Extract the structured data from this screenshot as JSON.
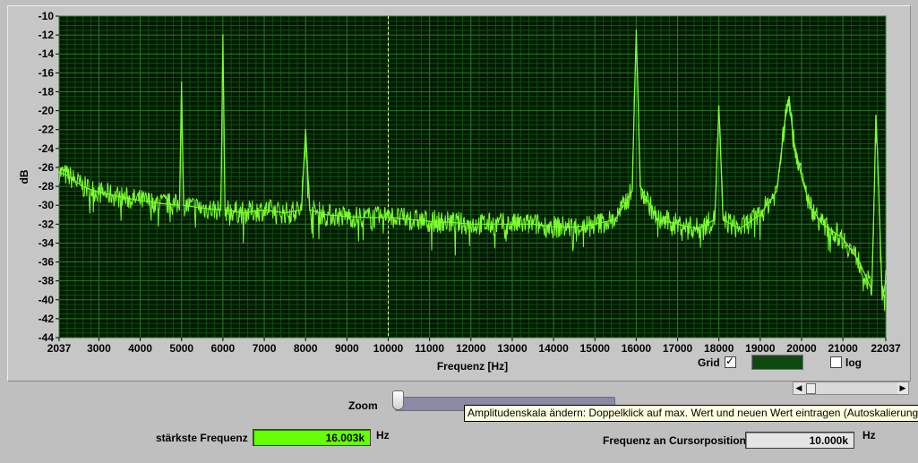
{
  "chart_data": {
    "type": "line",
    "xlabel": "Frequenz [Hz]",
    "ylabel": "dB",
    "xlim": [
      2037,
      22037
    ],
    "ylim": [
      -44,
      -10
    ],
    "xticks": [
      2037,
      3000,
      4000,
      5000,
      6000,
      7000,
      8000,
      9000,
      10000,
      11000,
      12000,
      13000,
      14000,
      15000,
      16000,
      17000,
      18000,
      19000,
      20000,
      21000,
      22037
    ],
    "yticks": [
      -10,
      -12,
      -14,
      -16,
      -18,
      -20,
      -22,
      -24,
      -26,
      -28,
      -30,
      -32,
      -34,
      -36,
      -38,
      -40,
      -42,
      -44
    ],
    "grid": true,
    "cursor_x": 10000,
    "series": [
      {
        "color": "#7cff2e",
        "x": [
          2037,
          2300,
          2600,
          2900,
          3200,
          3600,
          4000,
          4500,
          4950,
          5000,
          5050,
          5500,
          5950,
          6000,
          6050,
          6500,
          7000,
          7500,
          7900,
          8000,
          8100,
          8500,
          9000,
          9500,
          9900,
          10000,
          10100,
          10500,
          11000,
          11500,
          12000,
          12500,
          13000,
          13500,
          14000,
          14500,
          15000,
          15500,
          15900,
          16000,
          16100,
          16500,
          17000,
          17500,
          17900,
          18000,
          18100,
          18500,
          19000,
          19400,
          19600,
          19700,
          19800,
          20000,
          20200,
          20500,
          21000,
          21400,
          21700,
          21750,
          21800,
          21850,
          21950,
          22037
        ],
        "y": [
          -26.5,
          -27,
          -28,
          -28.5,
          -28.8,
          -29.2,
          -29.5,
          -29.8,
          -30,
          -17,
          -30,
          -30.3,
          -30.5,
          -12,
          -30.5,
          -30.8,
          -30.5,
          -30.8,
          -30.5,
          -22,
          -30.5,
          -31,
          -31.2,
          -31.3,
          -31.3,
          -30.5,
          -31.3,
          -31.5,
          -31.7,
          -31.8,
          -32,
          -32,
          -32,
          -32,
          -32.3,
          -32.3,
          -32,
          -31.5,
          -28.5,
          -11.5,
          -28,
          -31.5,
          -32,
          -32.5,
          -31.5,
          -19.5,
          -31.5,
          -32.5,
          -31,
          -28.5,
          -21,
          -18.5,
          -23,
          -27,
          -30,
          -32,
          -33.5,
          -36,
          -39,
          -30,
          -20.5,
          -26,
          -40,
          -38
        ]
      }
    ]
  },
  "controls": {
    "grid_label": "Grid",
    "grid_checked": "✓",
    "log_label": "log",
    "grid_color": "#0e4a0e",
    "zoom_label": "Zoom",
    "tooltip_text": "Amplitudenskala ändern: Doppelklick auf max. Wert und neuen Wert eintragen (Autoskalierung",
    "peak_label": "stärkste Frequenz",
    "peak_value": "16.003k",
    "peak_unit": "Hz",
    "cursor_label": "Frequenz an Cursorposition",
    "cursor_value": "10.000k",
    "cursor_unit": "Hz"
  }
}
